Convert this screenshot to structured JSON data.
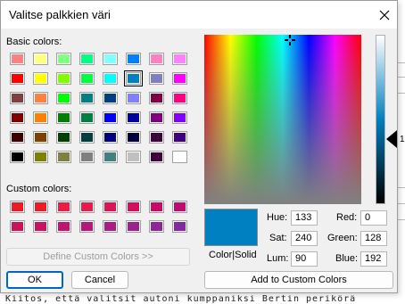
{
  "dialog": {
    "title": "Valitse palkkien väri",
    "basic_colors_label": "Basic colors:",
    "custom_colors_label": "Custom colors:",
    "define_custom_label": "Define Custom Colors >>",
    "ok_label": "OK",
    "cancel_label": "Cancel",
    "add_custom_label": "Add to Custom Colors",
    "color_solid_label": "Color|Solid"
  },
  "basic_colors": [
    [
      "#ff8080",
      "#ffff80",
      "#80ff80",
      "#00ff80",
      "#80ffff",
      "#0080ff",
      "#ff80c0",
      "#ff80ff"
    ],
    [
      "#ff0000",
      "#ffff00",
      "#80ff00",
      "#00ff40",
      "#00ffff",
      "#0080c0",
      "#8080c0",
      "#ff00ff"
    ],
    [
      "#804040",
      "#ff8040",
      "#00ff00",
      "#008080",
      "#004080",
      "#8080ff",
      "#800040",
      "#ff0080"
    ],
    [
      "#800000",
      "#ff8000",
      "#008000",
      "#008040",
      "#0000ff",
      "#0000a0",
      "#800080",
      "#8000ff"
    ],
    [
      "#400000",
      "#804000",
      "#004000",
      "#004040",
      "#000080",
      "#000040",
      "#400040",
      "#400080"
    ],
    [
      "#000000",
      "#808000",
      "#808040",
      "#808080",
      "#408080",
      "#c0c0c0",
      "#400040",
      "#ffffff"
    ]
  ],
  "custom_colors": [
    [
      "#ed1c24",
      "#ed1c24",
      "#ec1c44",
      "#e61a4b",
      "#dd1453",
      "#d40f5c",
      "#c80c66",
      "#c00a6f"
    ],
    [
      "#cc1258",
      "#c81361",
      "#c0156e",
      "#b6187a",
      "#a81d86",
      "#9c2290",
      "#8f2698",
      "#8229a1"
    ]
  ],
  "selected_color": {
    "hex": "#0080c0",
    "hue_label": "Hue:",
    "hue": "133",
    "sat_label": "Sat:",
    "sat": "240",
    "lum_label": "Lum:",
    "lum": "90",
    "red_label": "Red:",
    "red": "0",
    "green_label": "Green:",
    "green": "128",
    "blue_label": "Blue:",
    "blue": "192"
  },
  "background": {
    "text": "Kiitos, että valitsit autoni kumppaniksi Bertin perikörä",
    "edge_char": "1"
  },
  "icons": {
    "close": "close-icon",
    "crosshair": "crosshair-icon",
    "arrow": "luminance-arrow-icon"
  }
}
